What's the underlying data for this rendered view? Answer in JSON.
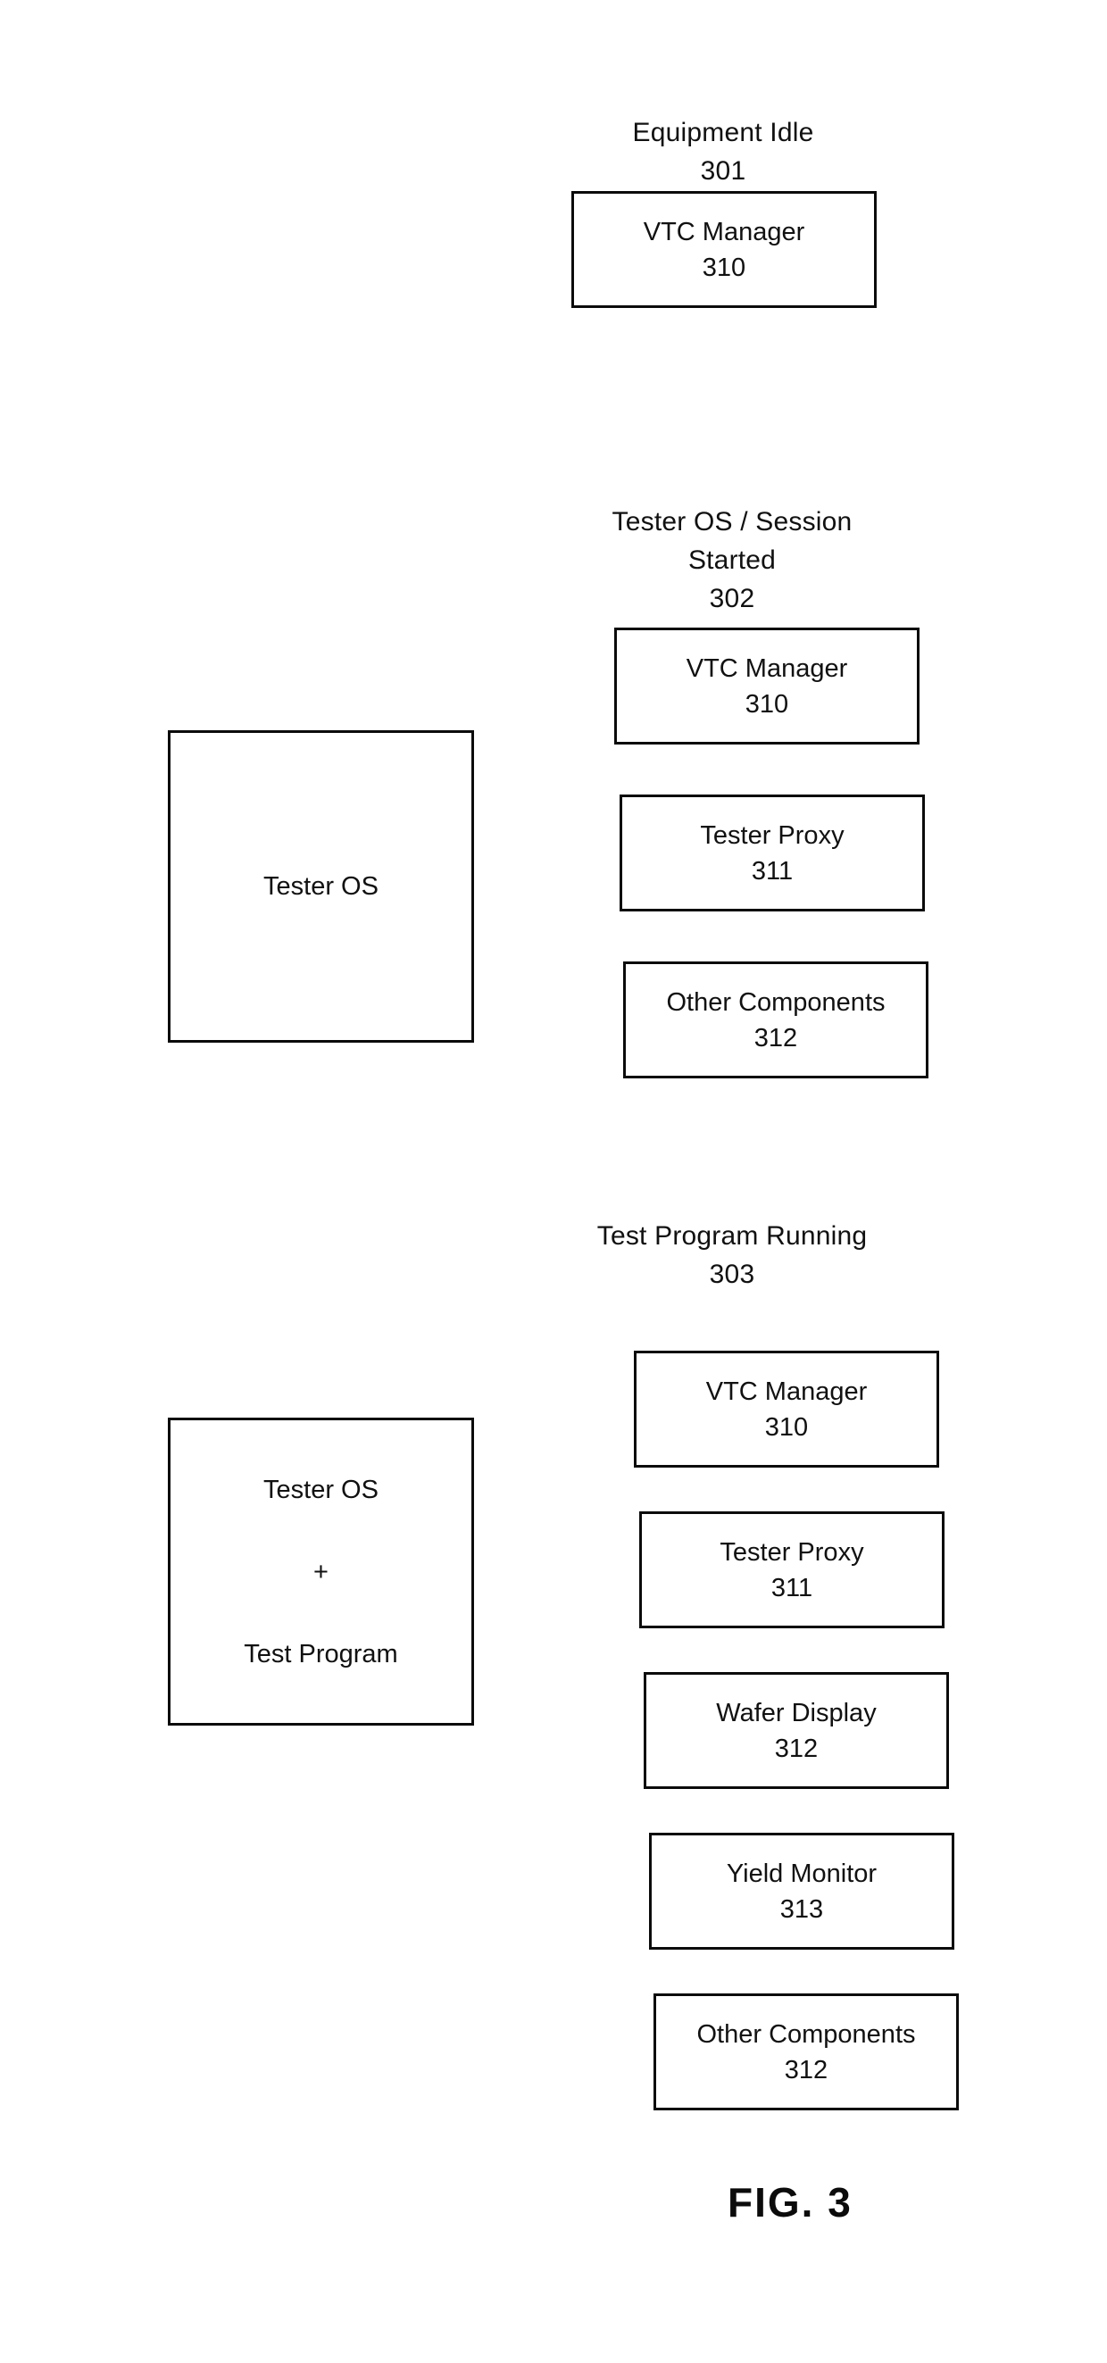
{
  "figure": {
    "label": "FIG. 3"
  },
  "sections": [
    {
      "id": "301",
      "caption": "Equipment Idle\n301",
      "caption_title": "Equipment Idle",
      "caption_ref": "301",
      "left_box": null,
      "stack": [
        {
          "title": "VTC Manager",
          "ref": "310"
        }
      ]
    },
    {
      "id": "302",
      "caption": "Tester OS / Session\nStarted\n302",
      "caption_title": "Tester OS / Session Started",
      "caption_ref": "302",
      "left_box": {
        "line1": "Tester OS",
        "line2": "",
        "line3": ""
      },
      "stack": [
        {
          "title": "VTC Manager",
          "ref": "310"
        },
        {
          "title": "Tester Proxy",
          "ref": "311"
        },
        {
          "title": "Other Components",
          "ref": "312"
        }
      ]
    },
    {
      "id": "303",
      "caption": "Test Program Running\n303",
      "caption_title": "Test Program Running",
      "caption_ref": "303",
      "left_box": {
        "line1": "Tester OS",
        "line2": "+",
        "line3": "Test Program"
      },
      "stack": [
        {
          "title": "VTC Manager",
          "ref": "310"
        },
        {
          "title": "Tester Proxy",
          "ref": "311"
        },
        {
          "title": "Wafer Display",
          "ref": "312"
        },
        {
          "title": "Yield Monitor",
          "ref": "313"
        },
        {
          "title": "Other Components",
          "ref": "312"
        }
      ]
    }
  ],
  "colors": {
    "ink": "#0b0b0b",
    "paper": "#ffffff"
  }
}
